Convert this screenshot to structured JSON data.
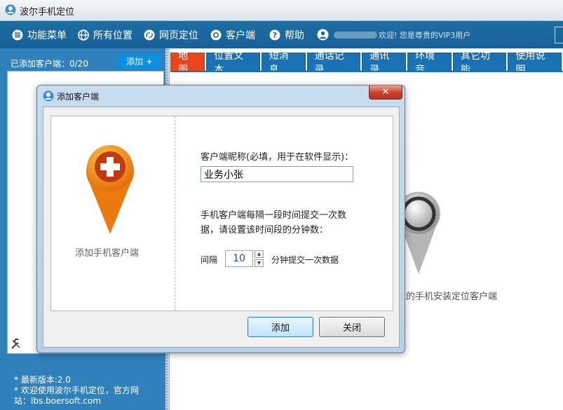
{
  "app": {
    "title": "波尔手机定位"
  },
  "menu": {
    "items": [
      {
        "label": "功能菜单",
        "icon": "list-icon"
      },
      {
        "label": "所有位置",
        "icon": "globe-icon"
      },
      {
        "label": "网页定位",
        "icon": "link-icon"
      },
      {
        "label": "客户端",
        "icon": "camera-icon"
      },
      {
        "label": "帮助",
        "icon": "help-icon"
      }
    ],
    "welcome": "欢迎! 您是尊贵的VIP3用户"
  },
  "sidebar": {
    "count_label": "已添加客户端：0/20",
    "add_label": "添加 +",
    "footer_lines": [
      "* 最新版本:2.0",
      "* 欢迎使用波尔手机定位，官方网",
      "站：lbs.boersoft.com"
    ]
  },
  "tabs": [
    "地图",
    "位置文本",
    "短消息",
    "通话记录",
    "通讯录",
    "环境音",
    "其它功能",
    "使用说明"
  ],
  "content": {
    "hint": "位的手机安装定位客户端"
  },
  "dialog": {
    "title": "添加客户端",
    "close_label": "✕",
    "pin_label": "添加手机客户端",
    "nickname_label": "客户端昵称(必填，用于在软件显示)：",
    "nickname_value": "业务小张",
    "desc_line1": "手机客户端每隔一段时间提交一次数",
    "desc_line2": "据，请设置该时间段的分钟数：",
    "interval_label": "间隔",
    "interval_value": "10",
    "interval_suffix": "分钟提交一次数据",
    "ok_label": "添加",
    "cancel_label": "关闭"
  },
  "colors": {
    "menubar": "#1a66a0",
    "accent_tab": "#e8461c",
    "tab": "#1a72b5",
    "pin": "#f08010"
  }
}
